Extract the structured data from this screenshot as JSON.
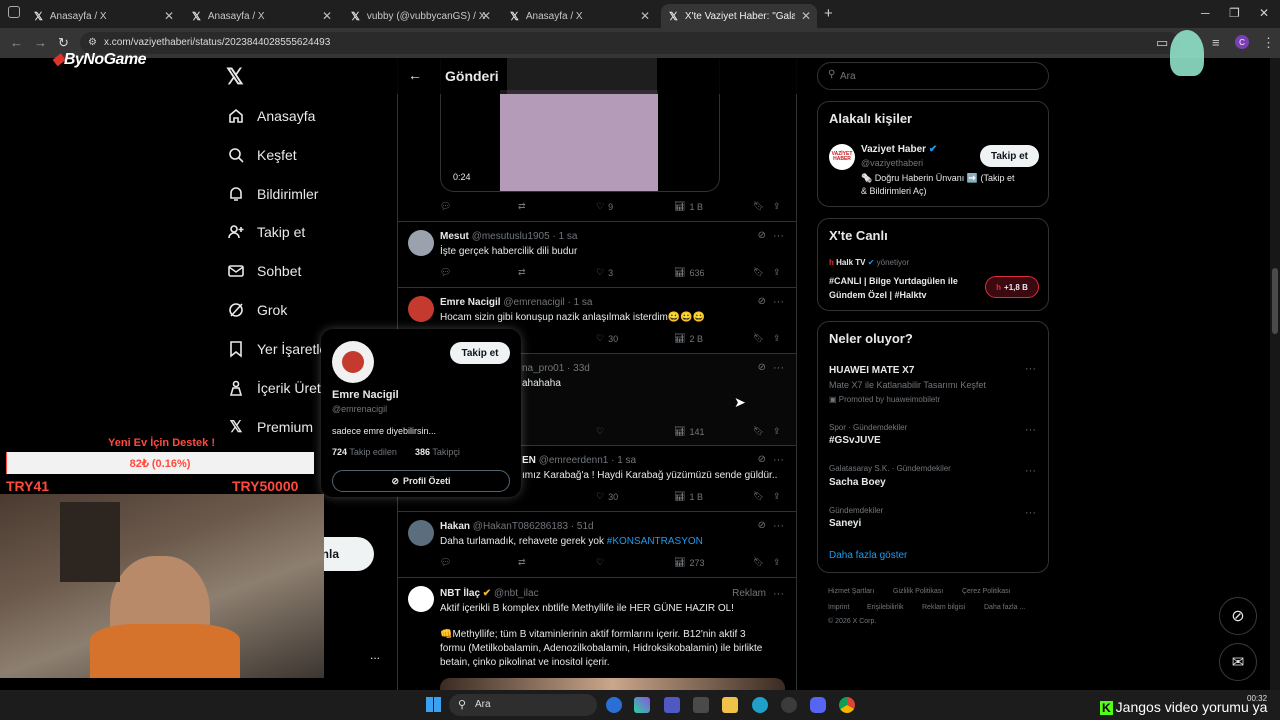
{
  "browser": {
    "tabs": [
      {
        "title": "Anasayfa / X"
      },
      {
        "title": "Anasayfa / X"
      },
      {
        "title": "vubby (@vubbycanGS) / X"
      },
      {
        "title": "Anasayfa / X"
      },
      {
        "title": "X'te Vaziyet Haber: \"Galatasaray"
      }
    ],
    "new_tab": "+",
    "url": "x.com/vaziyethaberi/status/2023844028555624493",
    "profile_initial": "C"
  },
  "overlay": {
    "watermark": "ByNoGame",
    "donation_title": "Yeni Ev İçin Destek !",
    "donation_progress_text": "82₺ (0.16%)",
    "donation_progress_fraction": 0.0016,
    "donation_min": "TRY41",
    "donation_max": "TRY50000",
    "ticker_text": "Jangos video yorumu ya"
  },
  "nav": {
    "items": [
      {
        "label": "Anasayfa",
        "icon": "home-icon"
      },
      {
        "label": "Keşfet",
        "icon": "search-icon"
      },
      {
        "label": "Bildirimler",
        "icon": "bell-icon"
      },
      {
        "label": "Takip et",
        "icon": "add-user-icon"
      },
      {
        "label": "Sohbet",
        "icon": "mail-icon"
      },
      {
        "label": "Grok",
        "icon": "grok-icon"
      },
      {
        "label": "Yer İşaretle",
        "icon": "bookmark-icon"
      },
      {
        "label": "İçerik Üret",
        "icon": "creator-icon"
      },
      {
        "label": "Premium",
        "icon": "x-icon"
      }
    ],
    "post_button_partial": "nla",
    "more": "..."
  },
  "post_header": {
    "title": "Gönderi"
  },
  "media": {
    "duration": "0:24"
  },
  "main_actions": {
    "likes": "9",
    "views": "1 B"
  },
  "replies": [
    {
      "name": "Mesut",
      "handle": "@mesutuslu1905",
      "time": "1 sa",
      "text": "İşte gerçek habercilik dili budur",
      "replies": "",
      "retweets": "",
      "likes": "3",
      "views": "636"
    },
    {
      "name": "Emre Nacigil",
      "handle": "@emrenacigil",
      "time": "1 sa",
      "text": "Hocam sizin gibi konuşup nazik anlaşılmak isterdim😀😀😀",
      "replies": "",
      "retweets": "",
      "likes": "30",
      "views": "2 B"
    },
    {
      "name": "",
      "handle": "na_pro01",
      "time": "33d",
      "text": "ahahaha",
      "replies": "",
      "retweets": "",
      "likes": "",
      "views": "141"
    },
    {
      "name": "EN",
      "handle": "@emreerdenn1",
      "time": "1 sa",
      "text": "ımız Karabağ'a ! Haydi Karabağ yüzümüzü sende güldür..",
      "replies": "",
      "retweets": "",
      "likes": "30",
      "views": "1 B"
    },
    {
      "name": "Hakan",
      "handle": "@HakanT086286183",
      "time": "51d",
      "text": "Daha turlamadık, rehavete gerek yok ",
      "hashtag": "#KONSANTRASYON",
      "replies": "",
      "retweets": "",
      "likes": "",
      "views": "273"
    }
  ],
  "ad": {
    "name": "NBT İlaç",
    "handle": "@nbt_ilac",
    "label": "Reklam",
    "line1": "Aktif içerikli B komplex nbtlife Methyllife ile HER GÜNE HAZIR OL!",
    "line2": "👊Methyllife; tüm B vitaminlerinin aktif formlarını içerir. B12'nin aktif 3",
    "line3": "formu (Metilkobalamin, Adenozilkobalamin, Hidroksikobalamin) ile birlikte",
    "line4": "betain, çinko pikolinat ve inositol içerir."
  },
  "popover": {
    "name": "Emre Nacigil",
    "handle": "@emrenacigil",
    "follow": "Takip et",
    "bio": "sadece emre diyebilirsin...",
    "following_count": "724",
    "following_label": "Takip edilen",
    "followers_count": "386",
    "followers_label": "Takipçi",
    "profile_summary": "Profil Özeti"
  },
  "sidebar": {
    "search_placeholder": "Ara",
    "relevant": {
      "title": "Alakalı kişiler",
      "name": "Vaziyet Haber",
      "handle": "@vaziyethaberi",
      "avatar_text": "VAZİYET HABER",
      "follow": "Takip et",
      "bio1": "🗞️ Doğru Haberin Ünvanı ➡️ (Takip et",
      "bio2": "& Bildirimleri Aç)"
    },
    "live": {
      "title": "X'te Canlı",
      "host": "Halk TV",
      "host_role": "yönetiyor",
      "line1": "#CANLI | Bilge Yurtdagülen ile",
      "line2": "Gündem Özel | #Halktv",
      "listeners": "+1,8 B"
    },
    "trends": {
      "title": "Neler oluyor?",
      "items": [
        {
          "context": "",
          "name": "HUAWEI MATE X7",
          "desc": "Mate X7 ile Katlanabilir Tasarımı Keşfet",
          "promo": "Promoted by huaweimobiletr"
        },
        {
          "context": "Spor · Gündemdekiler",
          "name": "#GSvJUVE"
        },
        {
          "context": "Galatasaray S.K. · Gündemdekiler",
          "name": "Sacha Boey"
        },
        {
          "context": "Gündemdekiler",
          "name": "Saneyi"
        }
      ],
      "show_more": "Daha fazla göster"
    },
    "footer": [
      "Hizmet Şartları",
      "Gizlilik Politikası",
      "Çerez Politikası",
      "Imprint",
      "Erişilebilirlik",
      "Reklam bilgisi",
      "Daha fazla ...",
      "© 2026 X Corp."
    ]
  },
  "taskbar": {
    "search": "Ara",
    "time": "00:32"
  }
}
